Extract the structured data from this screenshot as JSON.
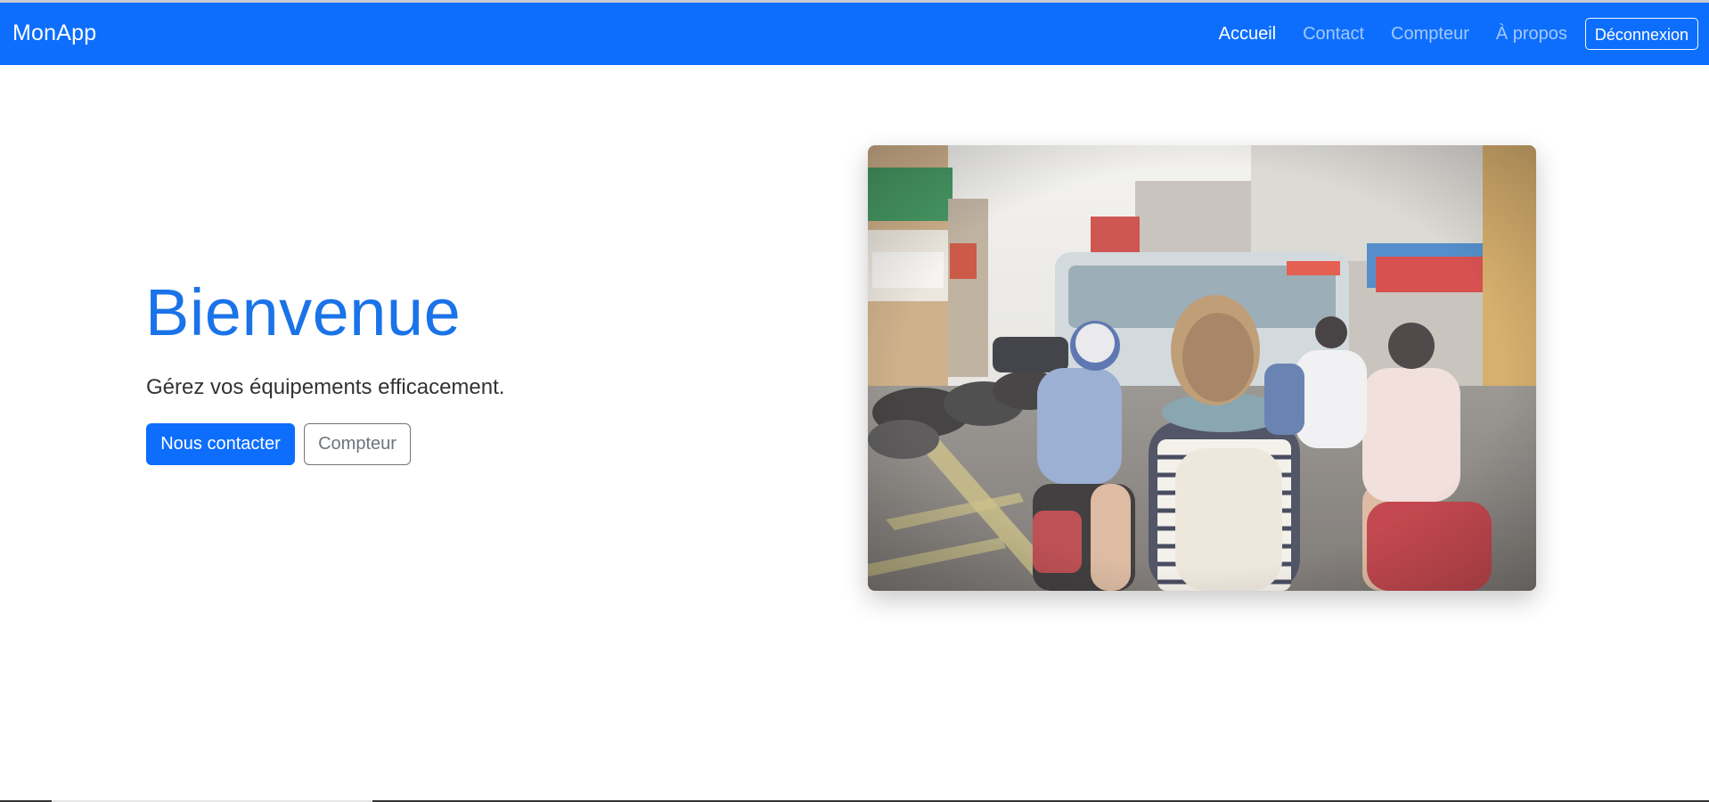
{
  "app": {
    "brand": "MonApp"
  },
  "nav": {
    "items": [
      {
        "label": "Accueil",
        "active": true
      },
      {
        "label": "Contact",
        "active": false
      },
      {
        "label": "Compteur",
        "active": false
      },
      {
        "label": "À propos",
        "active": false
      }
    ],
    "logout_label": "Déconnexion"
  },
  "hero": {
    "title": "Bienvenue",
    "subtitle": "Gérez vos équipements efficacement.",
    "primary_button": "Nous contacter",
    "secondary_button": "Compteur",
    "image": {
      "subject": "street-scene-photo"
    }
  },
  "colors": {
    "navbar": "#0d6efd",
    "title": "#1a73e8",
    "primary_button": "#0d6efd",
    "secondary_border": "#6c757d"
  }
}
